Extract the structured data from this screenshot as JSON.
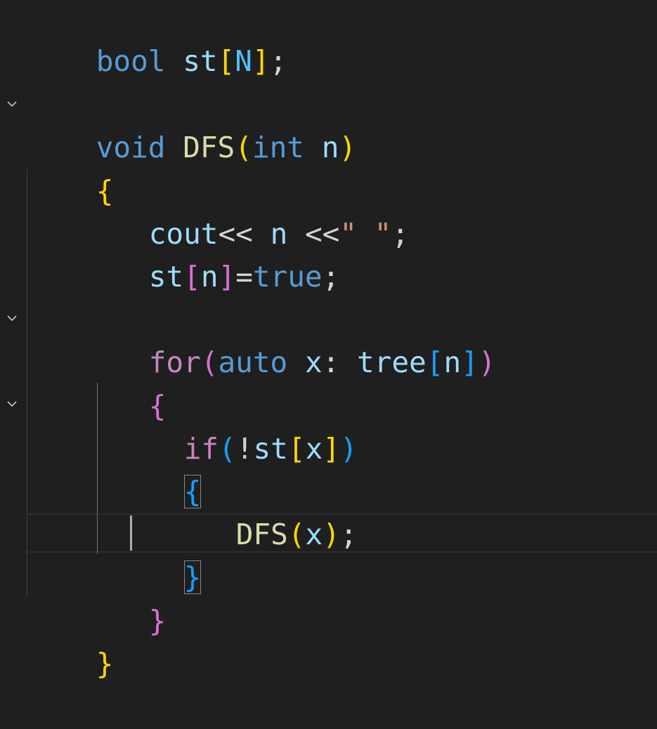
{
  "colors": {
    "background": "#1f1f1f",
    "keyword": "#569cd6",
    "control": "#c586c0",
    "function": "#dcdcaa",
    "variable": "#9cdcfe",
    "constant": "#4fc1ff",
    "string": "#ce9178",
    "bracket_level1": "#ffd700",
    "bracket_level2": "#da70d6",
    "bracket_level3": "#179fff"
  },
  "gutter": {
    "fold_icon": "chevron-down-icon"
  },
  "code": {
    "l1": {
      "t1": "bool",
      "t2": " ",
      "t3": "st",
      "t4": "[",
      "t5": "N",
      "t6": "]",
      "t7": ";"
    },
    "l3": {
      "t1": "void",
      "t2": " ",
      "t3": "DFS",
      "t4": "(",
      "t5": "int",
      "t6": " ",
      "t7": "n",
      "t8": ")"
    },
    "l4": {
      "t1": "{"
    },
    "l5": {
      "t1": "cout",
      "t2": "<<",
      "t3": " ",
      "t4": "n",
      "t5": " ",
      "t6": "<<",
      "t7": "\" \"",
      "t8": ";"
    },
    "l6": {
      "t1": "st",
      "t2": "[",
      "t3": "n",
      "t4": "]",
      "t5": "=",
      "t6": "true",
      "t7": ";"
    },
    "l8": {
      "t1": "for",
      "t2": "(",
      "t3": "auto",
      "t4": " ",
      "t5": "x",
      "t6": ": ",
      "t7": "tree",
      "t8": "[",
      "t9": "n",
      "t10": "]",
      "t11": ")"
    },
    "l9": {
      "t1": "{"
    },
    "l10": {
      "t1": "if",
      "t2": "(",
      "t3": "!",
      "t4": "st",
      "t5": "[",
      "t6": "x",
      "t7": "]",
      "t8": ")"
    },
    "l11": {
      "t1": "{"
    },
    "l12": {
      "t1": "DFS",
      "t2": "(",
      "t3": "x",
      "t4": ")",
      "t5": ";"
    },
    "l13": {
      "t1": "}"
    },
    "l14": {
      "t1": "}"
    },
    "l15": {
      "t1": "}"
    }
  }
}
